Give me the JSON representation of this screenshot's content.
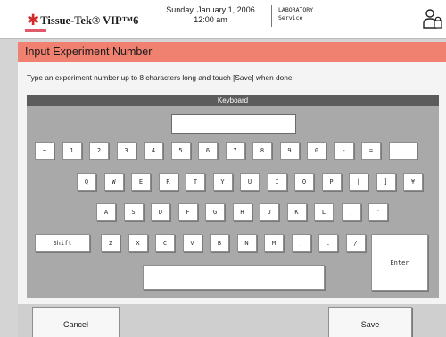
{
  "header": {
    "logo_text": "Tissue-Tek® VIP™6",
    "date": "Sunday, January 1, 2006",
    "time": "12:00 am",
    "mode_line1": "LABORATORY",
    "mode_line2": "Service",
    "user_icon": "user-lock-icon"
  },
  "dialog": {
    "title": "Input Experiment Number",
    "instruction": "Type an experiment number up to 8 characters long and touch [Save] when done."
  },
  "keyboard": {
    "title": "Keyboard",
    "input_value": "",
    "row1": [
      "~",
      "1",
      "2",
      "3",
      "4",
      "5",
      "6",
      "7",
      "8",
      "9",
      "0",
      "-",
      "=",
      ""
    ],
    "row2": [
      "Q",
      "W",
      "E",
      "R",
      "T",
      "Y",
      "U",
      "I",
      "O",
      "P",
      "[",
      "]",
      "¥"
    ],
    "row3": [
      "A",
      "S",
      "D",
      "F",
      "G",
      "H",
      "J",
      "K",
      "L",
      ";",
      "'"
    ],
    "row4": [
      "Z",
      "X",
      "C",
      "V",
      "B",
      "N",
      "M",
      ",",
      ".",
      "/"
    ],
    "shift_label": "Shift",
    "enter_label": "Enter",
    "space_label": ""
  },
  "buttons": {
    "cancel_label": "Cancel",
    "save_label": "Save"
  },
  "colors": {
    "title_bar": "#f08070",
    "keyboard_bg": "#a9a9a9",
    "logo_star": "#d42a2a"
  }
}
